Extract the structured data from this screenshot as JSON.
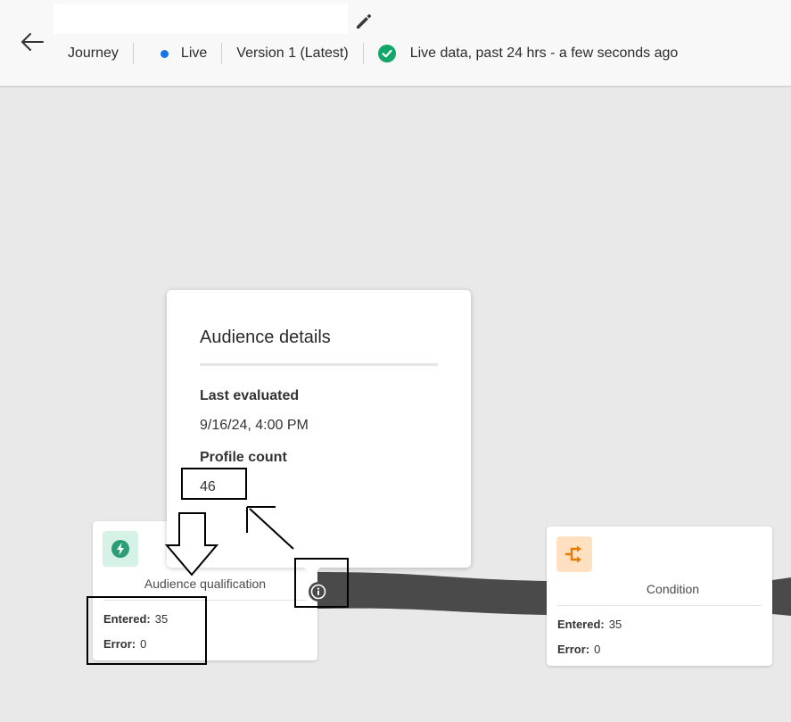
{
  "header": {
    "journey_label": "Journey",
    "status_label": "Live",
    "version_label": "Version 1 (Latest)",
    "live_data_label": "Live data, past 24 hrs - a few seconds ago",
    "status_color": "#1473e6",
    "check_color": "#12a66a",
    "icons": {
      "back": "arrow-left-icon",
      "edit": "pencil-icon",
      "check": "check-circle-icon"
    }
  },
  "popover": {
    "title": "Audience details",
    "last_evaluated_label": "Last evaluated",
    "last_evaluated_value": "9/16/24, 4:00 PM",
    "profile_count_label": "Profile count",
    "profile_count_value": "46"
  },
  "nodes": {
    "audience_qualification": {
      "label": "Audience qualification",
      "icon": "lightning-bolt-icon",
      "icon_color": "#2d9d78",
      "icon_bg": "#d6f1e6",
      "entered_label": "Entered:",
      "entered_value": "35",
      "error_label": "Error:",
      "error_value": "0"
    },
    "condition": {
      "label": "Condition",
      "icon": "split-arrows-icon",
      "icon_color": "#e67b00",
      "icon_bg": "#ffe1c2",
      "entered_label": "Entered:",
      "entered_value": "35",
      "error_label": "Error:",
      "error_value": "0"
    }
  }
}
